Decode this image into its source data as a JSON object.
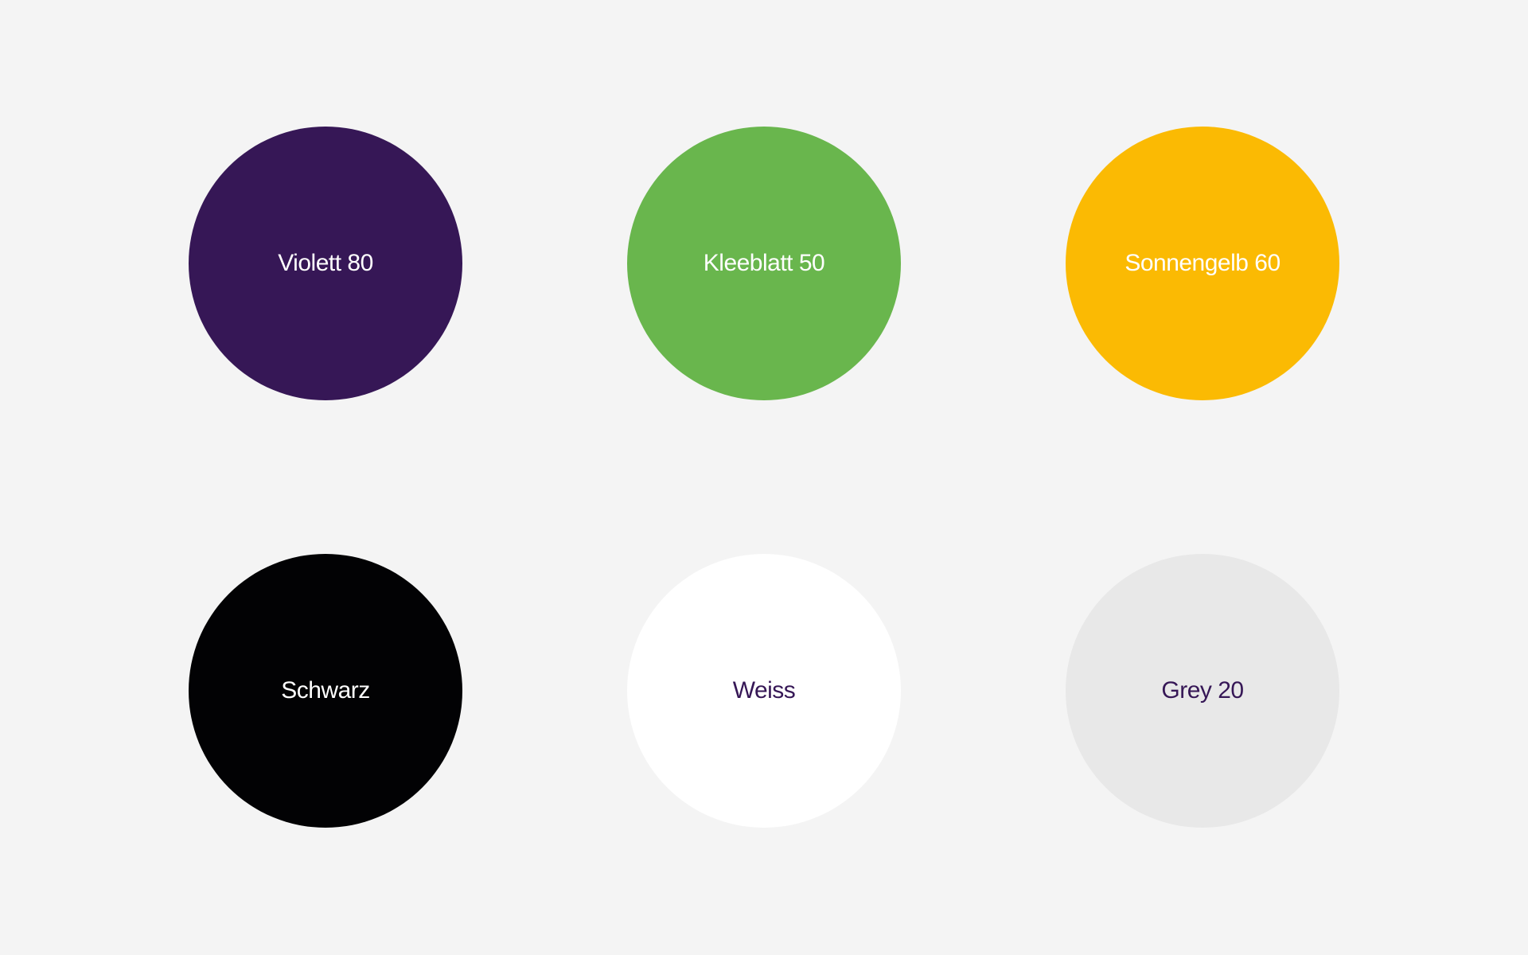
{
  "swatches": [
    {
      "label": "Violett 80",
      "color": "#361756",
      "text_color": "#ffffff"
    },
    {
      "label": "Kleeblatt 50",
      "color": "#69b64d",
      "text_color": "#ffffff"
    },
    {
      "label": "Sonnengelb 60",
      "color": "#fbba03",
      "text_color": "#ffffff"
    },
    {
      "label": "Schwarz",
      "color": "#020204",
      "text_color": "#ffffff"
    },
    {
      "label": "Weiss",
      "color": "#ffffff",
      "text_color": "#361756"
    },
    {
      "label": "Grey 20",
      "color": "#e8e8e8",
      "text_color": "#361756"
    }
  ]
}
